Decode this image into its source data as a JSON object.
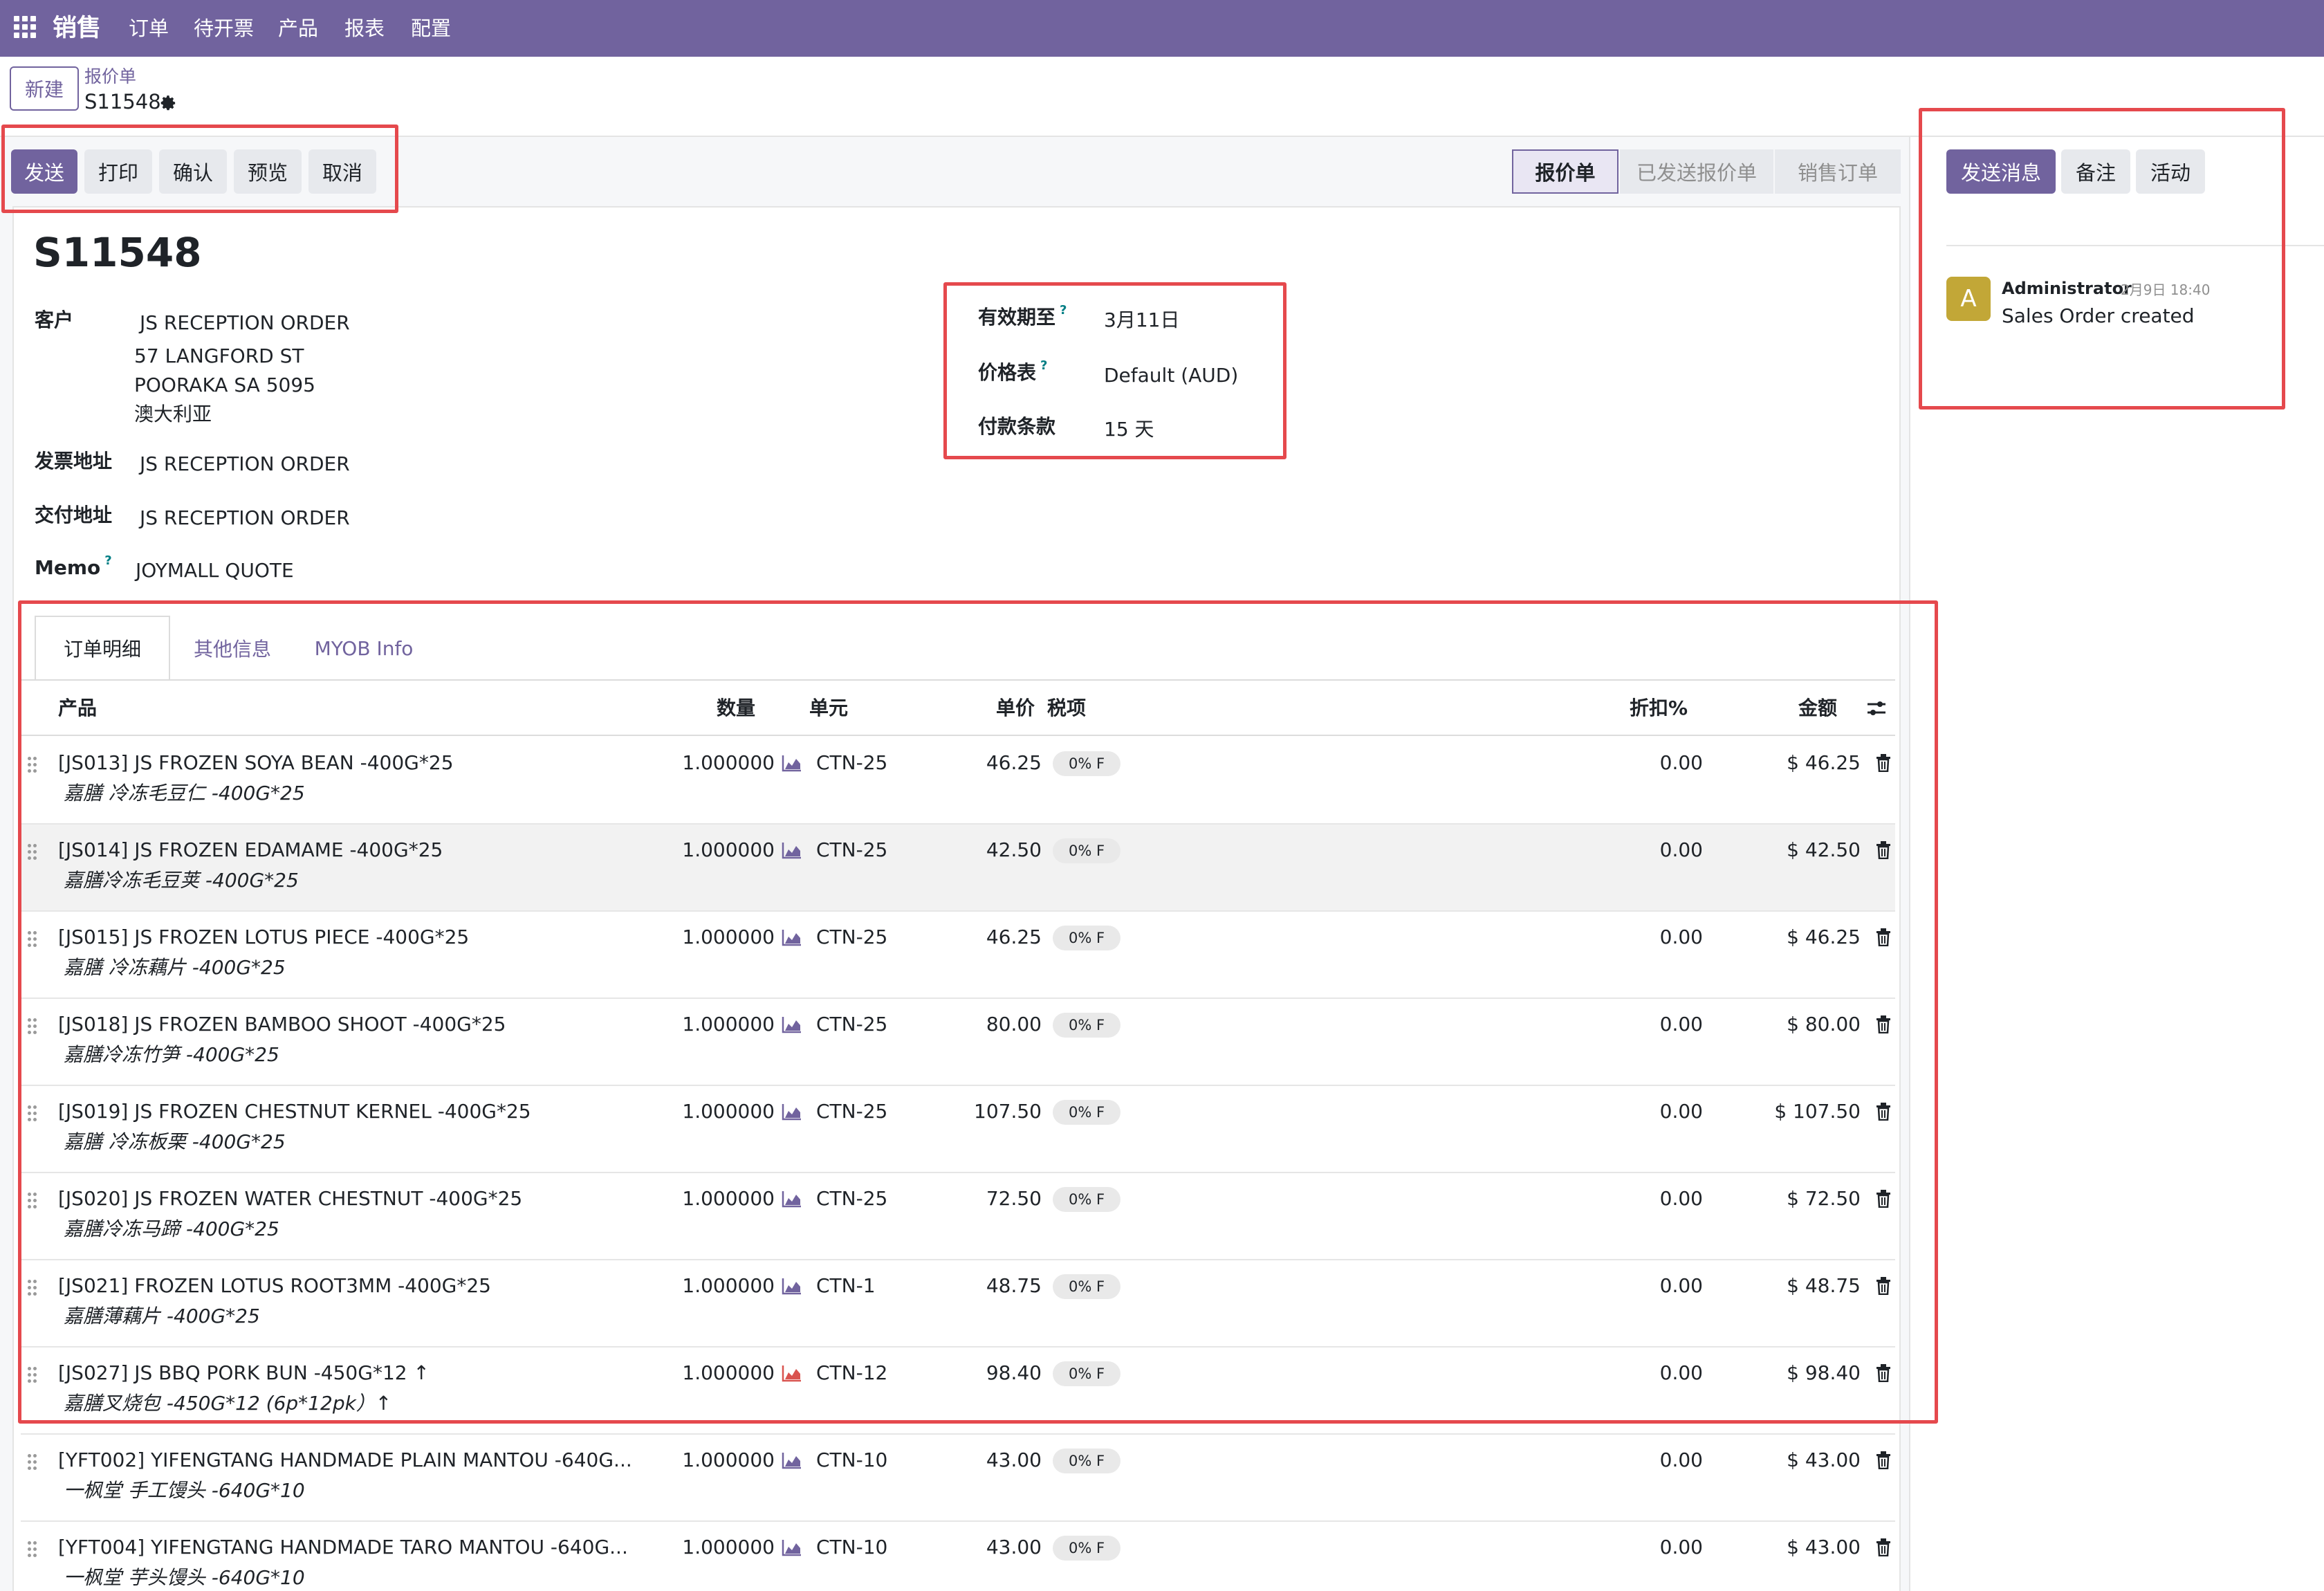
{
  "navbar": {
    "app_name": "销售",
    "menu": [
      "订单",
      "待开票",
      "产品",
      "报表",
      "配置"
    ]
  },
  "control": {
    "new_label": "新建",
    "breadcrumb_parent": "报价单",
    "breadcrumb_current": "S11548"
  },
  "actions": {
    "send": "发送",
    "print": "打印",
    "confirm": "确认",
    "preview": "预览",
    "cancel": "取消"
  },
  "stages": [
    {
      "label": "报价单",
      "active": true
    },
    {
      "label": "已发送报价单",
      "active": false
    },
    {
      "label": "销售订单",
      "active": false
    }
  ],
  "form": {
    "title": "S11548",
    "customer_label": "客户",
    "customer_name": "JS RECEPTION ORDER",
    "customer_address": [
      "57 LANGFORD ST",
      "POORAKA SA 5095",
      "澳大利亚"
    ],
    "invoice_label": "发票地址",
    "invoice_value": "JS RECEPTION ORDER",
    "delivery_label": "交付地址",
    "delivery_value": "JS RECEPTION ORDER",
    "memo_label": "Memo",
    "memo_value": "JOYMALL QUOTE",
    "help_mark": "?",
    "validity_label": "有效期至",
    "validity_value": "3月11日",
    "pricelist_label": "价格表",
    "pricelist_value": "Default (AUD)",
    "payment_label": "付款条款",
    "payment_value": "15 天"
  },
  "tabs": [
    "订单明细",
    "其他信息",
    "MYOB Info"
  ],
  "table": {
    "headers": {
      "product": "产品",
      "qty": "数量",
      "unit": "单元",
      "price": "单价",
      "tax": "税项",
      "discount": "折扣%",
      "amount": "金额"
    },
    "rows": [
      {
        "product": "[JS013] JS FROZEN SOYA BEAN -400G*25",
        "desc": "嘉膳 冷冻毛豆仁 -400G*25",
        "qty": "1.000000",
        "unit": "CTN-25",
        "price": "46.25",
        "tax": "0% F",
        "discount": "0.00",
        "amount": "$ 46.25",
        "chart_color": "#71639e"
      },
      {
        "product": "[JS014] JS FROZEN EDAMAME -400G*25",
        "desc": "嘉膳冷冻毛豆荚 -400G*25",
        "qty": "1.000000",
        "unit": "CTN-25",
        "price": "42.50",
        "tax": "0% F",
        "discount": "0.00",
        "amount": "$ 42.50",
        "chart_color": "#71639e"
      },
      {
        "product": "[JS015] JS FROZEN LOTUS PIECE -400G*25",
        "desc": "嘉膳 冷冻藕片 -400G*25",
        "qty": "1.000000",
        "unit": "CTN-25",
        "price": "46.25",
        "tax": "0% F",
        "discount": "0.00",
        "amount": "$ 46.25",
        "chart_color": "#71639e"
      },
      {
        "product": "[JS018] JS FROZEN BAMBOO SHOOT -400G*25",
        "desc": "嘉膳冷冻竹笋 -400G*25",
        "qty": "1.000000",
        "unit": "CTN-25",
        "price": "80.00",
        "tax": "0% F",
        "discount": "0.00",
        "amount": "$ 80.00",
        "chart_color": "#71639e"
      },
      {
        "product": "[JS019] JS FROZEN CHESTNUT KERNEL -400G*25",
        "desc": "嘉膳 冷冻板栗 -400G*25",
        "qty": "1.000000",
        "unit": "CTN-25",
        "price": "107.50",
        "tax": "0% F",
        "discount": "0.00",
        "amount": "$ 107.50",
        "chart_color": "#71639e"
      },
      {
        "product": "[JS020] JS FROZEN WATER CHESTNUT -400G*25",
        "desc": "嘉膳冷冻马蹄 -400G*25",
        "qty": "1.000000",
        "unit": "CTN-25",
        "price": "72.50",
        "tax": "0% F",
        "discount": "0.00",
        "amount": "$ 72.50",
        "chart_color": "#71639e"
      },
      {
        "product": "[JS021] FROZEN LOTUS ROOT3MM -400G*25",
        "desc": "嘉膳薄藕片 -400G*25",
        "qty": "1.000000",
        "unit": "CTN-1",
        "price": "48.75",
        "tax": "0% F",
        "discount": "0.00",
        "amount": "$ 48.75",
        "chart_color": "#71639e"
      },
      {
        "product": "[JS027] JS BBQ PORK BUN -450G*12 ↑",
        "desc": "嘉膳叉烧包 -450G*12 (6p*12pk）↑",
        "qty": "1.000000",
        "unit": "CTN-12",
        "price": "98.40",
        "tax": "0% F",
        "discount": "0.00",
        "amount": "$ 98.40",
        "chart_color": "#d9534f"
      },
      {
        "product": "[YFT002] YIFENGTANG HANDMADE PLAIN MANTOU -640G...",
        "desc": "一枫堂 手工馒头 -640G*10",
        "qty": "1.000000",
        "unit": "CTN-10",
        "price": "43.00",
        "tax": "0% F",
        "discount": "0.00",
        "amount": "$ 43.00",
        "chart_color": "#71639e"
      },
      {
        "product": "[YFT004] YIFENGTANG HANDMADE TARO MANTOU -640G...",
        "desc": "一枫堂 芋头馒头 -640G*10",
        "qty": "1.000000",
        "unit": "CTN-10",
        "price": "43.00",
        "tax": "0% F",
        "discount": "0.00",
        "amount": "$ 43.00",
        "chart_color": "#71639e"
      }
    ]
  },
  "chatter": {
    "send_message": "发送消息",
    "note": "备注",
    "activity": "活动",
    "message": {
      "avatar_letter": "A",
      "author": "Administrator",
      "date": "2月9日 18:40",
      "body": "Sales Order created"
    }
  },
  "colors": {
    "brand": "#71639e",
    "highlight": "#e5494d",
    "avatar": "#c2a737"
  }
}
